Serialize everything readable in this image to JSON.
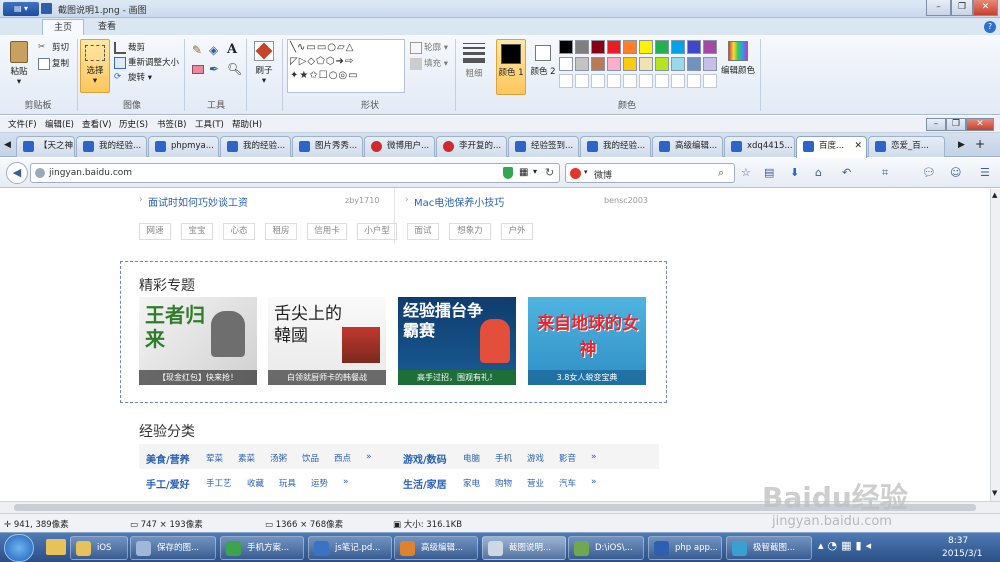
{
  "titlebar": {
    "title": "截图说明1.png - 画图"
  },
  "ribbon": {
    "tabs": [
      "主页",
      "查看"
    ],
    "clipboard": {
      "paste": "粘贴",
      "cut": "剪切",
      "copy": "复制",
      "label": "剪贴板"
    },
    "image": {
      "select": "选择",
      "crop": "裁剪",
      "resize": "重新调整大小",
      "rotate": "旋转",
      "label": "图像"
    },
    "tools": {
      "label": "工具"
    },
    "brushes": {
      "label": "刷子"
    },
    "shapes": {
      "outline": "轮廓",
      "fill": "填充",
      "label": "形状"
    },
    "size": {
      "label": "粗细"
    },
    "colors": {
      "color1": "颜色 1",
      "color2": "颜色 2",
      "edit": "编辑颜色",
      "label": "颜色",
      "color1_value": "#000000",
      "color2_value": "#ffffff",
      "palette": [
        "#000000",
        "#7f7f7f",
        "#880015",
        "#ed1c24",
        "#ff7f27",
        "#fff200",
        "#22b14c",
        "#00a2e8",
        "#3f48cc",
        "#a349a4",
        "#ffffff",
        "#c3c3c3",
        "#b97a57",
        "#ffaec9",
        "#ffc90e",
        "#efe4b0",
        "#b5e61d",
        "#99d9ea",
        "#7092be",
        "#c8bfe7"
      ]
    }
  },
  "browser": {
    "menu": [
      "文件(F)",
      "编辑(E)",
      "查看(V)",
      "历史(S)",
      "书签(B)",
      "工具(T)",
      "帮助(H)"
    ],
    "tabs": [
      "【天之神...",
      "我的经验...",
      "phpmya...",
      "我的经验...",
      "图片秀秀...",
      "微博用户...",
      "李开复的...",
      "经验签到...",
      "我的经验...",
      "高级编辑...",
      "xdq4415...",
      "百度...",
      "恋爱_百..."
    ],
    "url": "jingyan.baidu.com",
    "search": "微博"
  },
  "page": {
    "prev_items": [
      {
        "title": "面试时如何巧妙谈工资",
        "user": "zby1710"
      },
      {
        "title": "Mac电池保养小技巧",
        "user": "bensc2003"
      }
    ],
    "tags": [
      "网速",
      "宝宝",
      "心态",
      "租房",
      "信用卡",
      "小户型",
      "面试",
      "想象力",
      "户外"
    ],
    "featured_title": "精彩专题",
    "cards": [
      {
        "big": "王者归来",
        "caption": "【现金红包】快来抢！"
      },
      {
        "big": "舌尖上的韓國",
        "caption": "白领就厨师卡的韩餐战"
      },
      {
        "big": "经验擂台争霸赛",
        "caption": "高手过招，围观有礼！"
      },
      {
        "big": "来自地球的女神",
        "caption": "3.8女人蜕变宝典"
      }
    ],
    "categories_title": "经验分类",
    "categories": [
      {
        "name": "美食/营养",
        "items": [
          "荤菜",
          "素菜",
          "汤粥",
          "饮品",
          "西点"
        ]
      },
      {
        "name": "游戏/数码",
        "items": [
          "电脑",
          "手机",
          "游戏",
          "影音"
        ]
      },
      {
        "name": "手工/爱好",
        "items": [
          "手工艺",
          "收藏",
          "玩具",
          "运势"
        ]
      },
      {
        "name": "生活/家居",
        "items": [
          "家电",
          "购物",
          "营业",
          "汽车"
        ]
      }
    ]
  },
  "status": {
    "cursor": "941, 389像素",
    "selection": "747 × 193像素",
    "canvas": "1366 × 768像素",
    "size": "大小: 316.1KB"
  },
  "watermark": {
    "logo": "Baidu经验",
    "url": "jingyan.baidu.com"
  },
  "taskbar": {
    "items": [
      "iOS",
      "保存的图...",
      "手机方案...",
      "js笔记.pd...",
      "高级编辑...",
      "截图说明...",
      "D:\\iOS\\...",
      "php app...",
      "极智截图..."
    ],
    "time": "8:37",
    "date": "2015/3/1"
  }
}
